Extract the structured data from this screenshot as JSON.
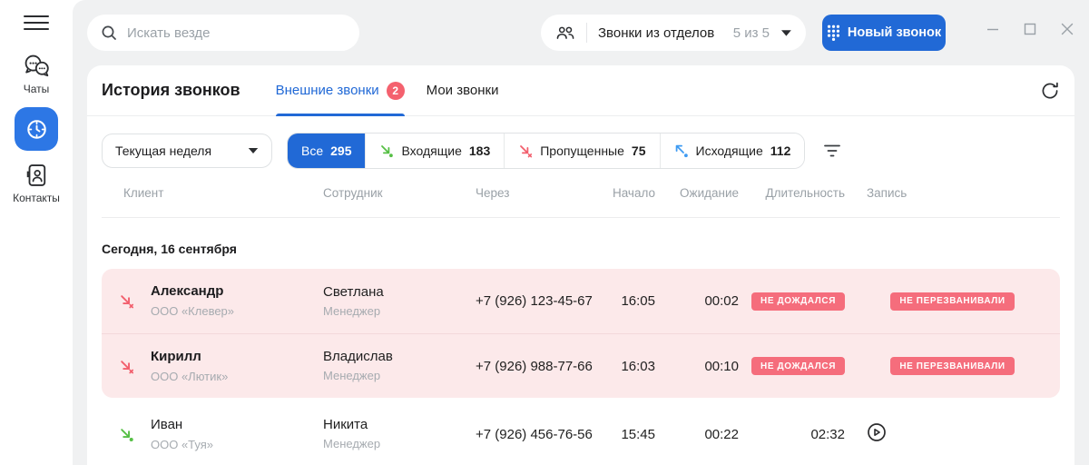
{
  "colors": {
    "accent": "#2169d6",
    "sidebar_active": "#2d77e5",
    "badge_bg": "#f56d7c",
    "tab_badge_bg": "#f4616e",
    "row_pink": "#fce9ea",
    "missed": "#f25f6d",
    "green": "#56bf45",
    "out_blue": "#3f9bf2",
    "bg_grey": "#f0f1f2",
    "text_grey": "#9aa1a7"
  },
  "sidebar": {
    "chats_label": "Чаты",
    "contacts_label": "Контакты"
  },
  "topbar": {
    "search_placeholder": "Искать везде",
    "departments_label": "Звонки из отделов",
    "departments_count": "5 из 5",
    "new_call_label": "Новый звонок"
  },
  "main": {
    "title": "История звонков",
    "tabs": [
      {
        "label": "Внешние звонки",
        "badge": "2"
      },
      {
        "label": "Мои звонки"
      }
    ],
    "filters": {
      "period": "Текущая неделя",
      "segments": [
        {
          "label": "Все",
          "count": "295"
        },
        {
          "label": "Входящие",
          "count": "183"
        },
        {
          "label": "Пропущенные",
          "count": "75"
        },
        {
          "label": "Исходящие",
          "count": "112"
        }
      ]
    },
    "table": {
      "columns": [
        "Клиент",
        "Сотрудник",
        "Через",
        "Начало",
        "Ожидание",
        "Длительность",
        "Запись"
      ],
      "date_group": "Сегодня, 16 сентября",
      "rows": [
        {
          "type": "missed",
          "client": "Александр",
          "company": "ООО «Клевер»",
          "employee": "Светлана",
          "role": "Менеджер",
          "via": "+7 (926) 123-45-67",
          "start": "16:05",
          "wait": "00:02",
          "duration_badge": "НЕ ДОЖДАЛСЯ",
          "record_badge": "НЕ ПЕРЕЗВАНИВАЛИ"
        },
        {
          "type": "missed",
          "client": "Кирилл",
          "company": "ООО «Лютик»",
          "employee": "Владислав",
          "role": "Менеджер",
          "via": "+7 (926) 988-77-66",
          "start": "16:03",
          "wait": "00:10",
          "duration_badge": "НЕ ДОЖДАЛСЯ",
          "record_badge": "НЕ ПЕРЕЗВАНИВАЛИ"
        },
        {
          "type": "incoming",
          "client": "Иван",
          "company": "ООО «Туя»",
          "employee": "Никита",
          "role": "Менеджер",
          "via": "+7 (926) 456-76-56",
          "start": "15:45",
          "wait": "00:22",
          "duration": "02:32"
        }
      ]
    }
  },
  "icons": {
    "menu": "hamburger",
    "chats": "speech-bubbles",
    "call-history": "clock",
    "contacts": "address-book",
    "search": "magnifier",
    "departments": "two-people",
    "caret": "triangle-down",
    "dialpad": "dot-grid",
    "minimize": "–",
    "maximize": "□",
    "close": "×",
    "refresh": "circular-arrow",
    "filter": "three-lines",
    "incoming-call": "green-arrow-down-right-dot",
    "missed-call": "red-arrow-down-right-x",
    "outgoing-call": "blue-arrow-up-left-dot",
    "play": "circle-triangle"
  }
}
